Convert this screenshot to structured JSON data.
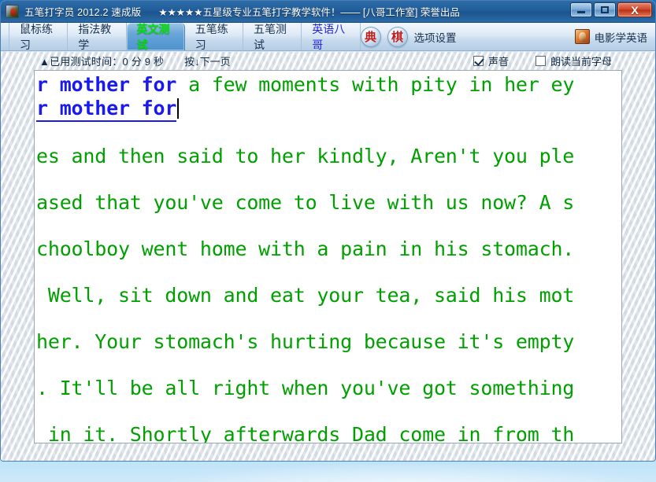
{
  "window": {
    "app_icon": "parrot-app-icon",
    "title": "五笔打字员 2012.2 速成版",
    "subtitle": "★★★★★五星级专业五笔打字教学软件！—— [八哥工作室] 荣誉出品",
    "controls": {
      "minimize": "–",
      "maximize": "□",
      "close": "X"
    }
  },
  "toolbar": {
    "tabs": [
      {
        "label": "鼠标练习",
        "active": false,
        "color": "normal"
      },
      {
        "label": "指法教学",
        "active": false,
        "color": "normal"
      },
      {
        "label": "英文测试",
        "active": true,
        "color": "green"
      },
      {
        "label": "五笔练习",
        "active": false,
        "color": "normal"
      },
      {
        "label": "五笔测试",
        "active": false,
        "color": "normal"
      },
      {
        "label": "英语八哥",
        "active": false,
        "color": "blue"
      }
    ],
    "round_buttons": [
      {
        "label": "典",
        "name": "dictionary-button"
      },
      {
        "label": "棋",
        "name": "chess-button"
      }
    ],
    "options_label": "选项设置",
    "movie_icon": "parrot-movie-icon",
    "movie_label": "电影学英语"
  },
  "status": {
    "time_text": "▲已用测试时间：0 分  9 秒",
    "hint_text": "按↓下一页",
    "sound": {
      "label": "声音",
      "checked": true
    },
    "read_letter": {
      "label": "朗读当前字母",
      "checked": false
    }
  },
  "text": {
    "line1_typed": "r mother for ",
    "line1_rest": "a few moments with pity in her ey",
    "input_value": "r mother for",
    "lines": [
      "es and then said to her kindly, Aren't you ple",
      "ased that you've come to live with us now? A s",
      "choolboy went home with a pain in his stomach.",
      " Well, sit down and eat your tea, said his mot",
      "her. Your stomach's hurting because it's empty",
      ". It'll be all right when you've got something",
      " in it. Shortly afterwards Dad come in from th"
    ]
  },
  "colors": {
    "prompt_green": "#00a000",
    "typed_blue": "#1a1aee",
    "titlebar_blue": "#215d98",
    "tab_active_green": "#00e000"
  }
}
